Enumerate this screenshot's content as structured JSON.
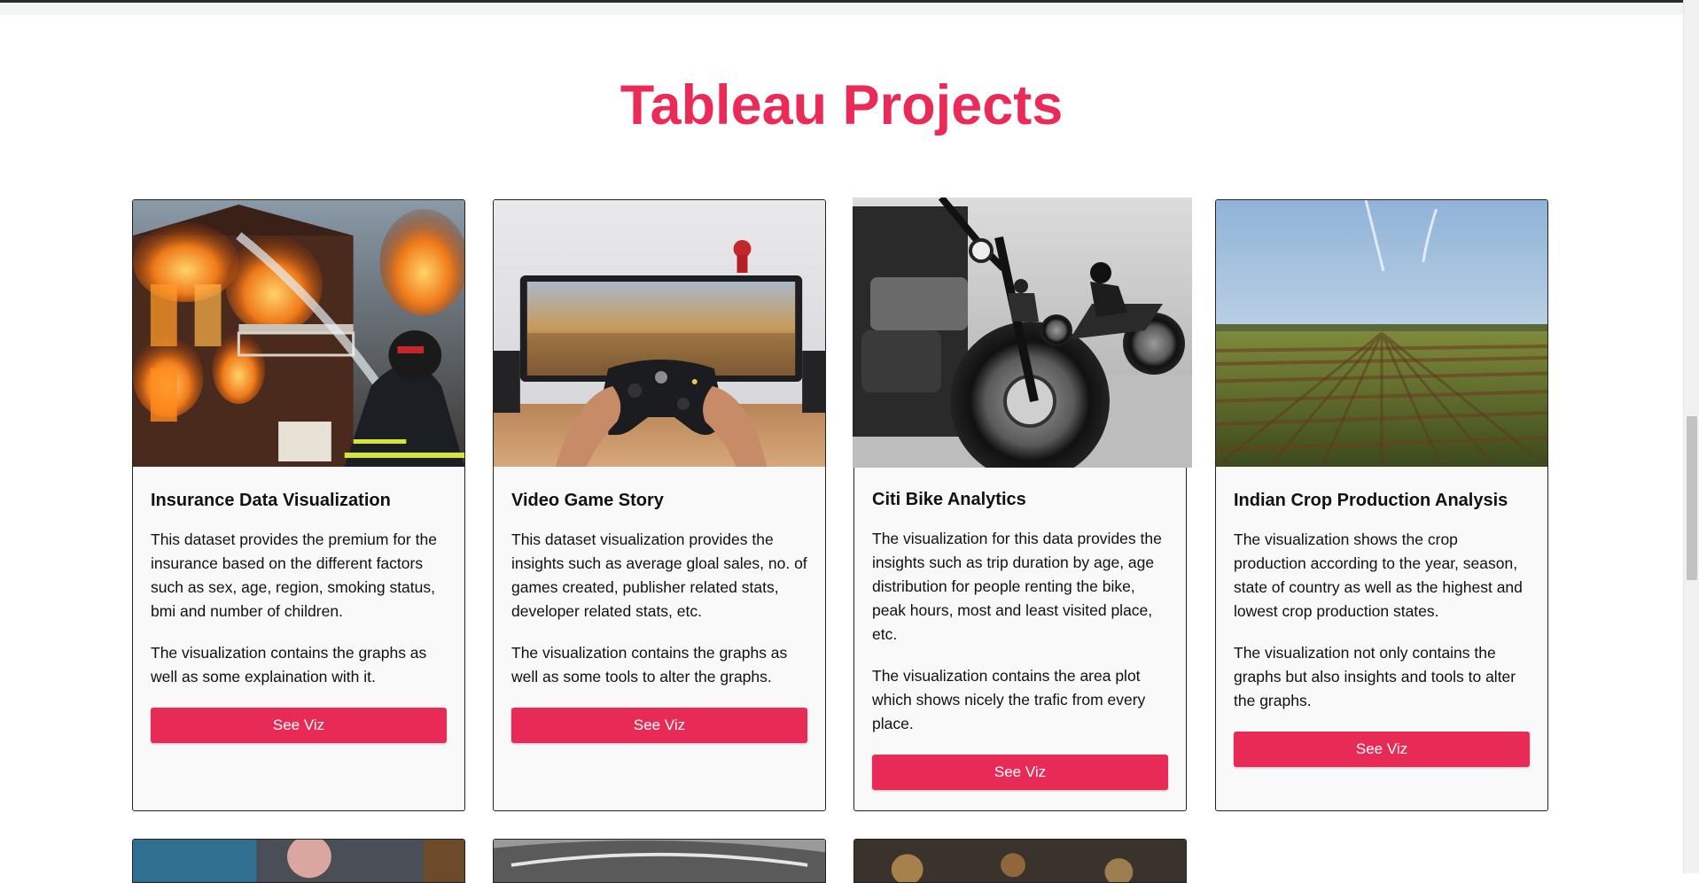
{
  "page": {
    "title": "Tableau Projects",
    "accent_color": "#ea2b57"
  },
  "projects": [
    {
      "title": "Insurance Data Visualization",
      "image": "burning-house-firefighter-photo",
      "paragraphs": [
        "This dataset provides the premium for the insurance based on the different factors such as sex, age, region, smoking status, bmi and number of children.",
        "The visualization contains the graphs as well as some explaination with it."
      ],
      "button_label": "See Viz"
    },
    {
      "title": "Video Game Story",
      "image": "game-controller-monitor-photo",
      "paragraphs": [
        "This dataset visualization provides the insights such as average gloal sales, no. of games created, publisher related stats, developer related stats, etc.",
        "The visualization contains the graphs as well as some tools to alter the graphs."
      ],
      "button_label": "See Viz"
    },
    {
      "title": "Citi Bike Analytics",
      "image": "motorcycles-black-white-photo",
      "paragraphs": [
        "The visualization for this data provides the insights such as trip duration by age, age distribution for people renting the bike, peak hours, most and least visited place, etc.",
        "The visualization contains the area plot which shows nicely the trafic from every place."
      ],
      "button_label": "See Viz"
    },
    {
      "title": "Indian Crop Production Analysis",
      "image": "crop-field-rows-photo",
      "paragraphs": [
        "The visualization shows the crop production according to the year, season, state of country as well as the highest and lowest crop production states.",
        "The visualization not only contains the graphs but also insights and tools to alter the graphs."
      ],
      "button_label": "See Viz"
    }
  ]
}
